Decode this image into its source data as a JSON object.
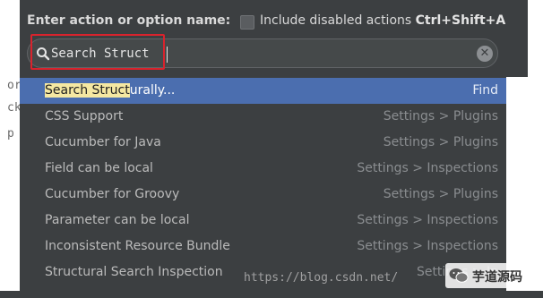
{
  "header": {
    "prompt_label": "Enter action or option name:",
    "disabled_label": "Include disabled actions ",
    "disabled_shortcut": "Ctrl+Shift+A",
    "disabled_checked": false
  },
  "search": {
    "value": "Search Struct"
  },
  "results": [
    {
      "match": "Search Struct",
      "rest": "urally...",
      "category": "Find",
      "selected": true
    },
    {
      "match": "",
      "rest": "CSS Support",
      "category": "Settings > Plugins",
      "selected": false
    },
    {
      "match": "",
      "rest": "Cucumber for Java",
      "category": "Settings > Plugins",
      "selected": false
    },
    {
      "match": "",
      "rest": "Field can be local",
      "category": "Settings > Inspections",
      "selected": false
    },
    {
      "match": "",
      "rest": "Cucumber for Groovy",
      "category": "Settings > Plugins",
      "selected": false
    },
    {
      "match": "",
      "rest": "Parameter can be local",
      "category": "Settings > Inspections",
      "selected": false
    },
    {
      "match": "",
      "rest": "Inconsistent Resource Bundle",
      "category": "Settings > Inspections",
      "selected": false
    },
    {
      "match": "",
      "rest": "Structural Search Inspection",
      "category": "Settings > In",
      "selected": false
    }
  ],
  "background_glyphs": [
    "or",
    "ck",
    "p"
  ],
  "watermark": "https://blog.csdn.net/",
  "wechat": {
    "label": "芋道源码",
    "icon": "wechat-icon"
  },
  "colors": {
    "popup_bg": "#3c3f41",
    "selection": "#4b6eaf",
    "match_highlight": "#f5e8a2",
    "annotation_box": "#d9232d"
  }
}
